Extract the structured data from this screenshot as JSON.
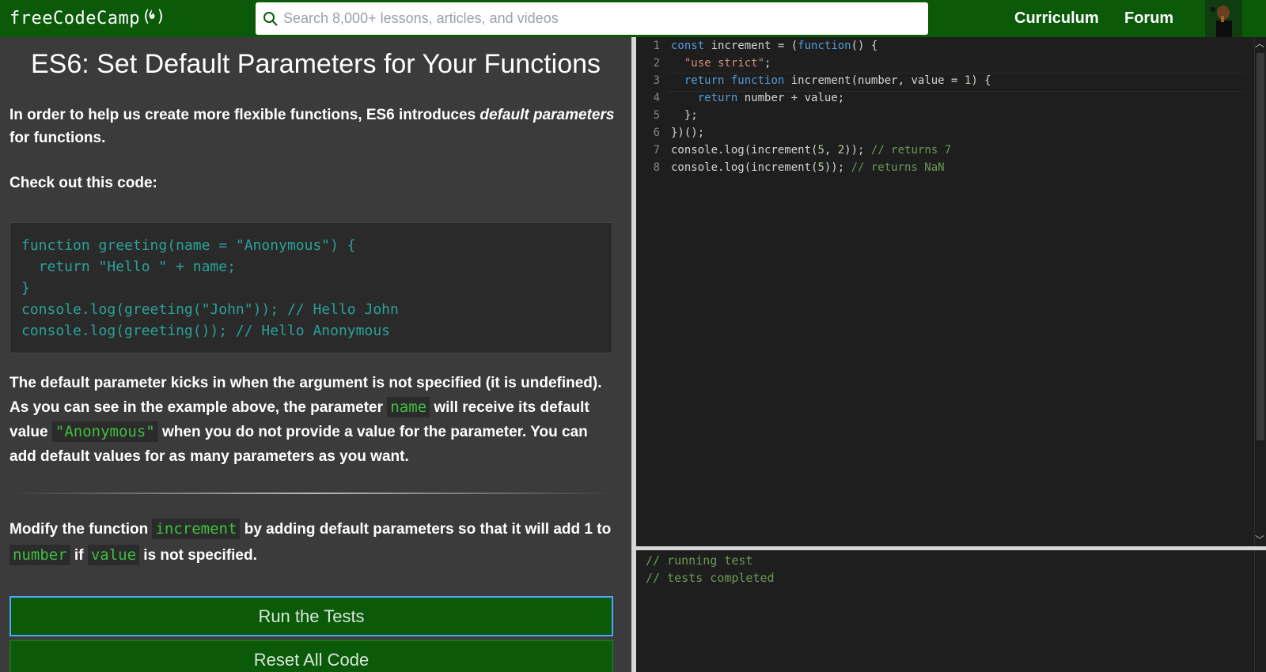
{
  "nav": {
    "logo_text": "freeCodeCamp",
    "search_placeholder": "Search 8,000+ lessons, articles, and videos",
    "links": [
      "Curriculum",
      "Forum"
    ]
  },
  "lesson": {
    "title": "ES6: Set Default Parameters for Your Functions",
    "intro_prefix": "In order to help us create more flexible functions, ES6 introduces ",
    "intro_em": "default parameters",
    "intro_suffix": " for functions.",
    "check_code": "Check out this code:",
    "example_code": "function greeting(name = \"Anonymous\") {\n  return \"Hello \" + name;\n}\nconsole.log(greeting(\"John\")); // Hello John\nconsole.log(greeting()); // Hello Anonymous",
    "explain_1": "The default parameter kicks in when the argument is not specified (it is undefined). As you can see in the example above, the parameter ",
    "explain_code_1": "name",
    "explain_2": " will receive its default value ",
    "explain_code_2": "\"Anonymous\"",
    "explain_3": " when you do not provide a value for the parameter. You can add default values for as many parameters as you want.",
    "task_1": "Modify the function ",
    "task_code_1": "increment",
    "task_2": " by adding default parameters so that it will add 1 to ",
    "task_code_2": "number",
    "task_3": " if ",
    "task_code_3": "value",
    "task_4": " is not specified.",
    "run_button": "Run the Tests",
    "reset_button": "Reset All Code"
  },
  "editor": {
    "lines": [
      {
        "n": "1",
        "code": "const increment = (function() {"
      },
      {
        "n": "2",
        "code": "  \"use strict\";"
      },
      {
        "n": "3",
        "code": "  return function increment(number, value = 1) {"
      },
      {
        "n": "4",
        "code": "    return number + value;"
      },
      {
        "n": "5",
        "code": "  };"
      },
      {
        "n": "6",
        "code": "})();"
      },
      {
        "n": "7",
        "code": "console.log(increment(5, 2)); // returns 7"
      },
      {
        "n": "8",
        "code": "console.log(increment(5)); // returns NaN"
      }
    ]
  },
  "output": {
    "lines": [
      "// running test",
      "// tests completed"
    ]
  }
}
